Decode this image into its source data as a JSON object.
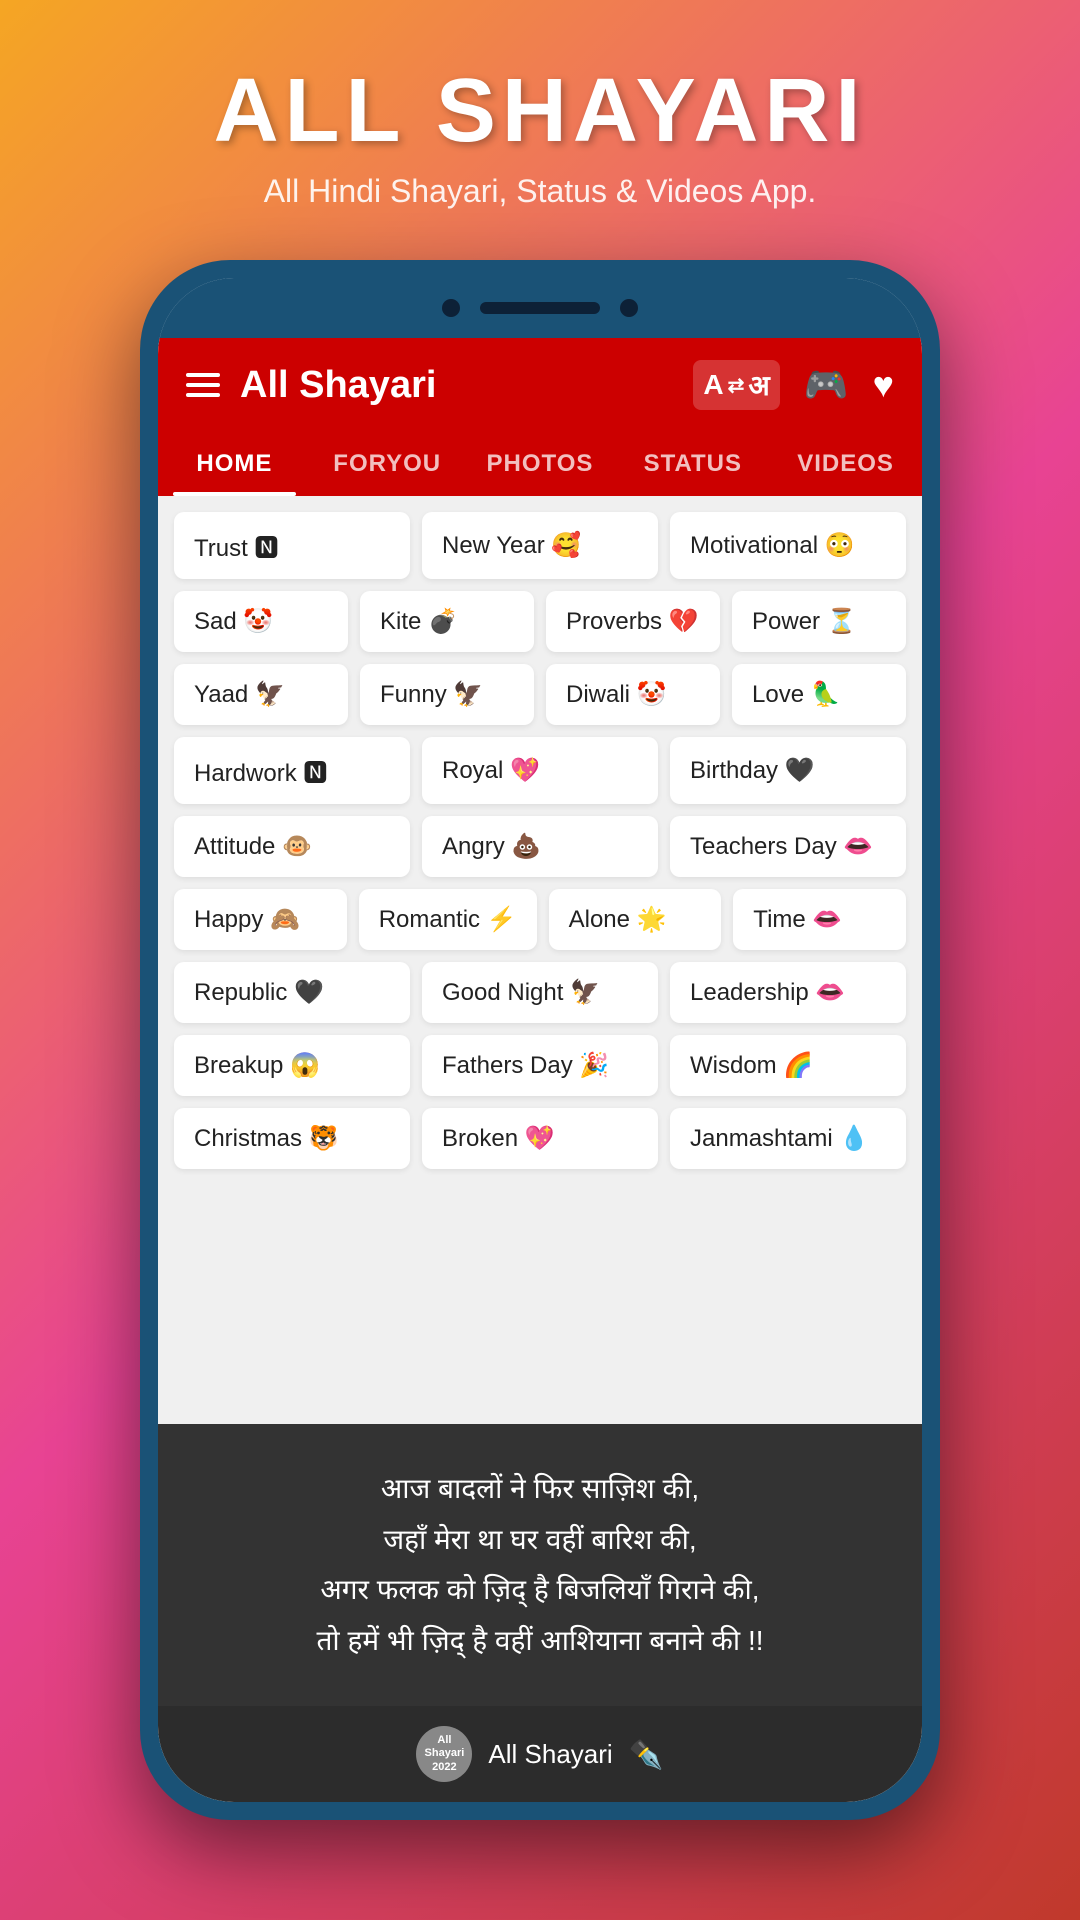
{
  "header": {
    "title": "ALL SHAYARI",
    "subtitle": "All Hindi Shayari, Status & Videos App."
  },
  "topbar": {
    "app_name": "All Shayari",
    "menu_icon": "☰",
    "translate_label": "A",
    "translate_label2": "अ",
    "game_icon": "🎮",
    "heart_icon": "♥"
  },
  "tabs": [
    {
      "label": "HOME",
      "active": true
    },
    {
      "label": "FORYOU",
      "active": false
    },
    {
      "label": "PHOTOS",
      "active": false
    },
    {
      "label": "STATUS",
      "active": false
    },
    {
      "label": "VIDEOS",
      "active": false
    }
  ],
  "categories": [
    [
      {
        "label": "Trust 🅽",
        "size": "wide"
      },
      {
        "label": "New Year 🥰",
        "size": "wide"
      },
      {
        "label": "Motivational 😳",
        "size": "wide"
      }
    ],
    [
      {
        "label": "Sad 🤡",
        "size": "wide"
      },
      {
        "label": "Kite 💣",
        "size": "wide"
      },
      {
        "label": "Proverbs 💔",
        "size": "wide"
      },
      {
        "label": "Power ⏳",
        "size": "wide"
      }
    ],
    [
      {
        "label": "Yaad 🦅",
        "size": "wide"
      },
      {
        "label": "Funny 🦅",
        "size": "wide"
      },
      {
        "label": "Diwali 🤡",
        "size": "wide"
      },
      {
        "label": "Love 🦜",
        "size": "wide"
      }
    ],
    [
      {
        "label": "Hardwork 🅽",
        "size": "wide"
      },
      {
        "label": "Royal 💖",
        "size": "wide"
      },
      {
        "label": "Birthday 🖤",
        "size": "wide"
      }
    ],
    [
      {
        "label": "Attitude 🐵",
        "size": "wide"
      },
      {
        "label": "Angry 💩",
        "size": "wide"
      },
      {
        "label": "Teachers Day 👄",
        "size": "wide"
      }
    ],
    [
      {
        "label": "Happy 🙈",
        "size": "wide"
      },
      {
        "label": "Romantic ⚡",
        "size": "wide"
      },
      {
        "label": "Alone 🌟",
        "size": "wide"
      },
      {
        "label": "Time 👄",
        "size": "wide"
      }
    ],
    [
      {
        "label": "Republic 🖤",
        "size": "wide"
      },
      {
        "label": "Good Night 🦅",
        "size": "wide"
      },
      {
        "label": "Leadership 👄",
        "size": "wide"
      }
    ],
    [
      {
        "label": "Breakup 😱",
        "size": "wide"
      },
      {
        "label": "Fathers Day 🎉",
        "size": "wide"
      },
      {
        "label": "Wisdom 🌈",
        "size": "wide"
      }
    ],
    [
      {
        "label": "Christmas 🐯",
        "size": "wide"
      },
      {
        "label": "Broken 💖",
        "size": "wide"
      },
      {
        "label": "Janmashtami 💧",
        "size": "wide"
      }
    ]
  ],
  "poetry": {
    "lines": [
      "आज बादलों ने फिर साज़िश की,",
      "जहाँ मेरा था घर वहीं बारिश की,",
      "अगर फलक को ज़िद् है बिजलियाँ गिराने की,",
      "तो हमें भी ज़िद् है वहीं आशियाना बनाने की !!"
    ]
  },
  "footer": {
    "logo_text": "All\nShayari\n2022",
    "name": "All Shayari",
    "icon": "✒️"
  }
}
